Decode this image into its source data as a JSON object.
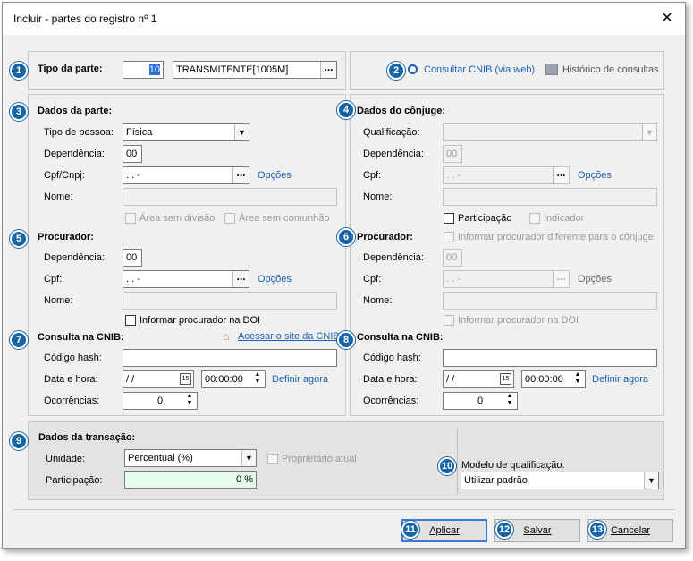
{
  "window": {
    "title": "Incluir - partes do registro nº 1",
    "close_glyph": "✕"
  },
  "tipo_parte": {
    "label": "Tipo da parte:",
    "code": "10",
    "value": "TRANSMITENTE[1005M]",
    "dots": "..."
  },
  "cnib_links": {
    "consultar": "Consultar CNIB (via web)",
    "historico": "Histórico de consultas"
  },
  "dados_parte": {
    "title": "Dados da parte:",
    "tipo_pessoa_label": "Tipo de pessoa:",
    "tipo_pessoa_value": "Física",
    "dependencia_label": "Dependência:",
    "dependencia_value": "00",
    "cpf_label": "Cpf/Cnpj:",
    "cpf_value": " .   .   -",
    "opcoes": "Opções",
    "nome_label": "Nome:",
    "nome_value": "",
    "area_sem_divisao": "Área sem divisão",
    "area_sem_comunhao": "Área sem comunhão"
  },
  "procurador_parte": {
    "title": "Procurador:",
    "dependencia_label": "Dependência:",
    "dependencia_value": "00",
    "cpf_label": "Cpf:",
    "cpf_value": " .   .   -",
    "opcoes": "Opções",
    "nome_label": "Nome:",
    "nome_value": "",
    "informar_doi": "Informar procurador na DOI"
  },
  "consulta_parte": {
    "title": "Consulta na CNIB:",
    "acessar": "Acessar o site da CNIB",
    "hash_label": "Código hash:",
    "hash_value": "",
    "data_label": "Data e hora:",
    "data_value": " / /",
    "hora_value": "00:00:00",
    "definir": "Definir agora",
    "ocorrencias_label": "Ocorrências:",
    "ocorrencias_value": "0"
  },
  "dados_conjuge": {
    "title": "Dados do cônjuge:",
    "qualificacao_label": "Qualificação:",
    "qualificacao_value": "",
    "dependencia_label": "Dependência:",
    "dependencia_value": "00",
    "cpf_label": "Cpf:",
    "cpf_value": " .   .   -",
    "opcoes": "Opções",
    "nome_label": "Nome:",
    "nome_value": "",
    "participacao": "Participação",
    "indicador": "Indicador"
  },
  "procurador_conjuge": {
    "title": "Procurador:",
    "informar_diferente": "Informar procurador diferente para o cônjuge",
    "dependencia_label": "Dependência:",
    "dependencia_value": "00",
    "cpf_label": "Cpf:",
    "cpf_value": " .   .   -",
    "opcoes": "Opções",
    "nome_label": "Nome:",
    "nome_value": "",
    "informar_doi": "Informar procurador na DOI"
  },
  "consulta_conjuge": {
    "title": "Consulta na CNIB:",
    "hash_label": "Código hash:",
    "hash_value": "",
    "data_label": "Data e hora:",
    "data_value": " / /",
    "hora_value": "00:00:00",
    "definir": "Definir agora",
    "ocorrencias_label": "Ocorrências:",
    "ocorrencias_value": "0"
  },
  "transacao": {
    "title": "Dados da transação:",
    "unidade_label": "Unidade:",
    "unidade_value": "Percentual (%)",
    "proprietario": "Proprietário atual",
    "participacao_label": "Participação:",
    "participacao_value": "0 %",
    "modelo_label": "Modelo de qualificação:",
    "modelo_value": "Utilizar padrão"
  },
  "buttons": {
    "aplicar": "Aplicar",
    "salvar": "Salvar",
    "cancelar": "Cancelar"
  },
  "badges": [
    "1",
    "2",
    "3",
    "4",
    "5",
    "6",
    "7",
    "8",
    "9",
    "10",
    "11",
    "12",
    "13"
  ],
  "colors": {
    "badge": "#1565a8",
    "link": "#1a5fb4",
    "participacao_bg": "#e6fbef"
  }
}
